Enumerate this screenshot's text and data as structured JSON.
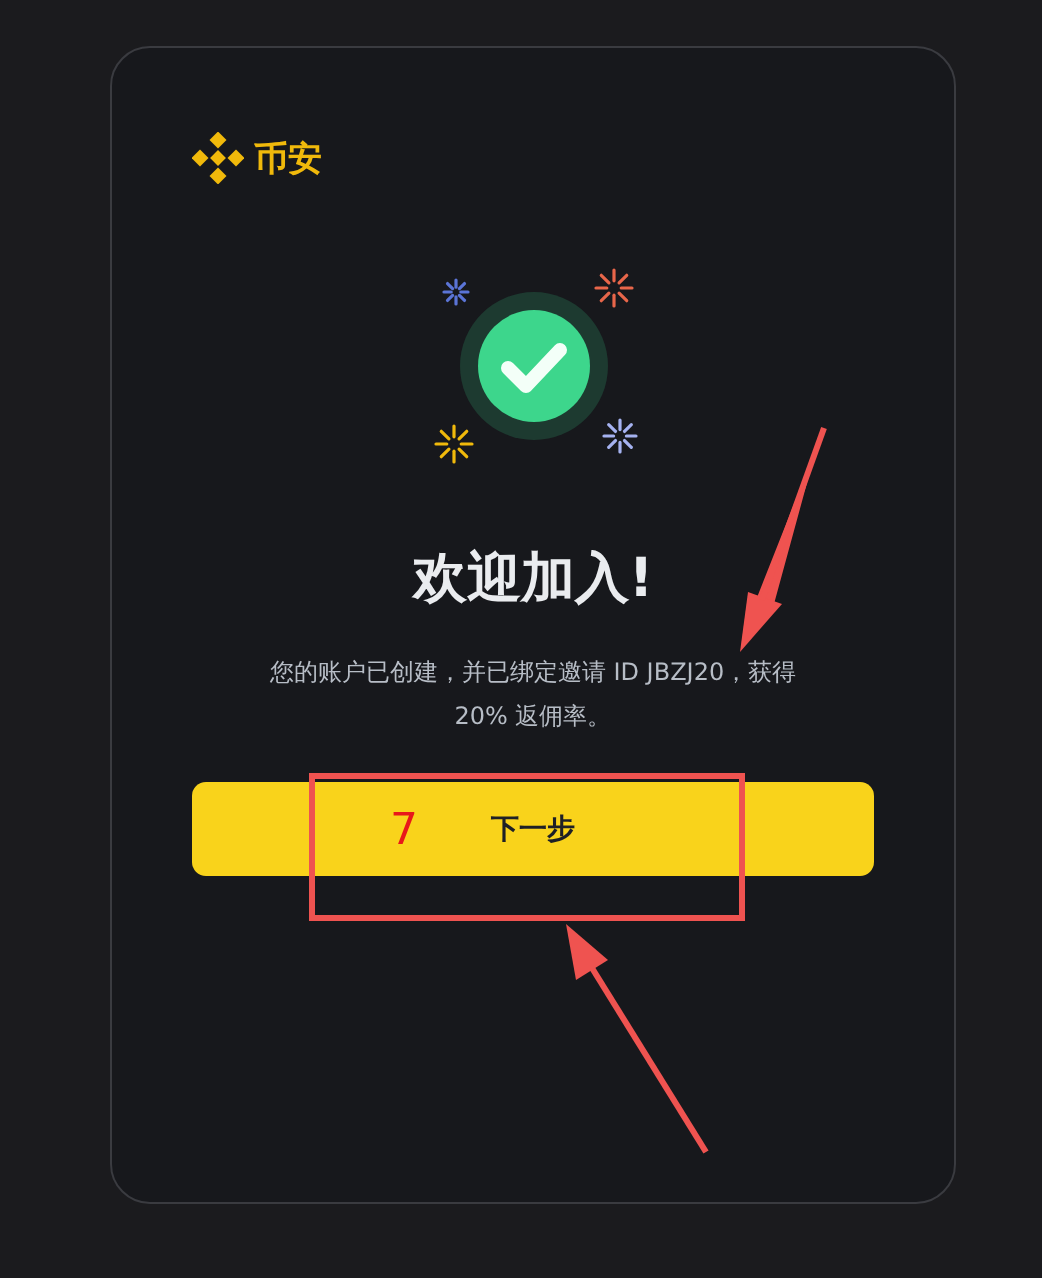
{
  "brand": {
    "name": "币安"
  },
  "title": "欢迎加入!",
  "description": "您的账户已创建，并已绑定邀请 ID JBZJ20，获得 20% 返佣率。",
  "button": {
    "label": "下一步"
  },
  "annotation": {
    "label": "7"
  }
}
